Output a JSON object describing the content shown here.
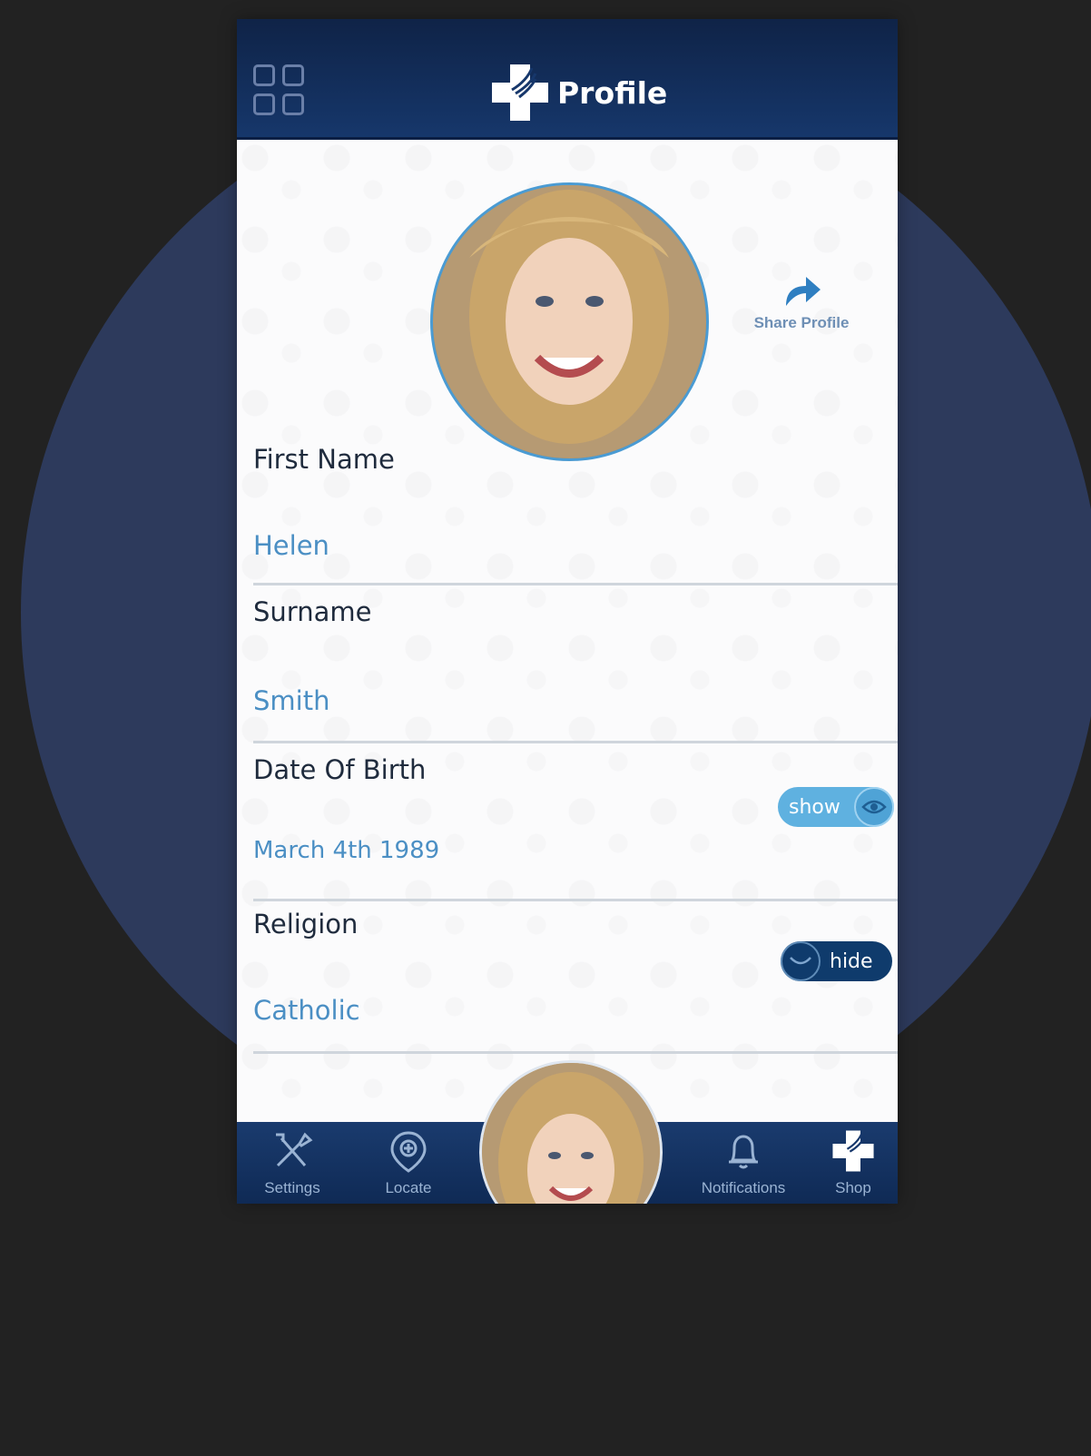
{
  "header": {
    "title": "Profile"
  },
  "share": {
    "label": "Share Profile"
  },
  "fields": [
    {
      "label": "First Name",
      "value": "Helen"
    },
    {
      "label": "Surname",
      "value": "Smith"
    },
    {
      "label": "Date Of Birth",
      "value": "March 4th 1989",
      "visibility": "show"
    },
    {
      "label": "Religion",
      "value": "Catholic",
      "visibility": "hide"
    }
  ],
  "nav": {
    "settings": "Settings",
    "locate": "Locate",
    "notifications": "Notifications",
    "shop": "Shop"
  },
  "colors": {
    "header": "#16376b",
    "accent": "#4b8fc4",
    "toggle_show": "#5fb1e0",
    "toggle_hide": "#0f3b6c",
    "backdrop_circle": "#2d3a5c"
  },
  "icons": {
    "menu": "grid-icon",
    "logo": "medical-cross-logo-icon",
    "share": "share-arrow-icon",
    "show": "eye-icon",
    "hide": "eye-closed-icon",
    "settings": "tools-icon",
    "locate": "location-pin-icon",
    "notifications": "bell-icon",
    "shop": "medical-cross-icon"
  }
}
